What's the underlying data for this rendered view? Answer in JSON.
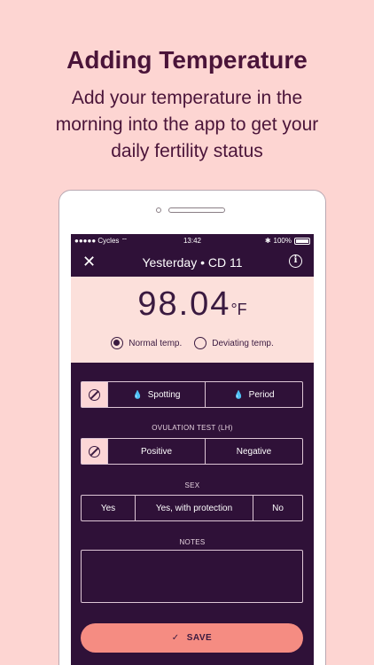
{
  "promo": {
    "title": "Adding Temperature",
    "subtitle": "Add your temperature in the morning into the app to get your daily fertility status"
  },
  "status_bar": {
    "carrier": "●●●●● Cycles",
    "time": "13:42",
    "battery": "100%"
  },
  "nav": {
    "title": "Yesterday • CD 11",
    "close_icon": "close-icon",
    "info_icon": "info-icon"
  },
  "temperature": {
    "value": "98.04",
    "unit": "°F",
    "options": [
      {
        "label": "Normal temp.",
        "selected": true
      },
      {
        "label": "Deviating temp.",
        "selected": false
      }
    ]
  },
  "bleeding": {
    "options": [
      "Spotting",
      "Period"
    ]
  },
  "ovulation": {
    "label": "OVULATION TEST (LH)",
    "options": [
      "Positive",
      "Negative"
    ]
  },
  "sex": {
    "label": "SEX",
    "options": [
      "Yes",
      "Yes, with protection",
      "No"
    ]
  },
  "notes": {
    "label": "NOTES",
    "value": ""
  },
  "save": {
    "label": "SAVE"
  },
  "colors": {
    "background": "#fdd5d2",
    "screen": "#2f1138",
    "accent": "#f58c82",
    "title": "#4a1439"
  }
}
